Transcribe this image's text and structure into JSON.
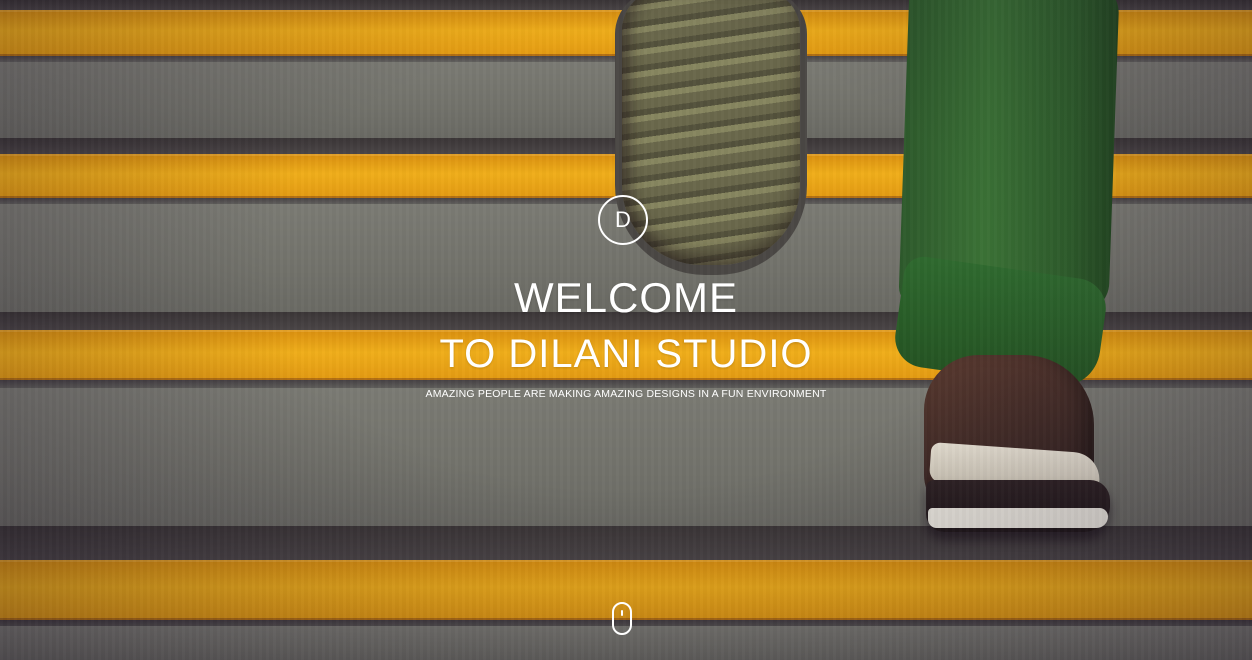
{
  "hero": {
    "logo_letter": "D",
    "title_line1": "WELCOME",
    "title_line2": "TO DILANI STUDIO",
    "tagline": "AMAZING PEOPLE ARE MAKING AMAZING DESIGNS IN A FUN ENVIRONMENT",
    "background_image": "stairs-with-yellow-stripes-and-walking-feet",
    "scroll_indicator_icon": "mouse-scroll-icon"
  },
  "colors": {
    "text": "#ffffff",
    "stripe_yellow": "#f0ae1a",
    "step_gray": "#75766f",
    "trouser_green": "#3b7236"
  }
}
